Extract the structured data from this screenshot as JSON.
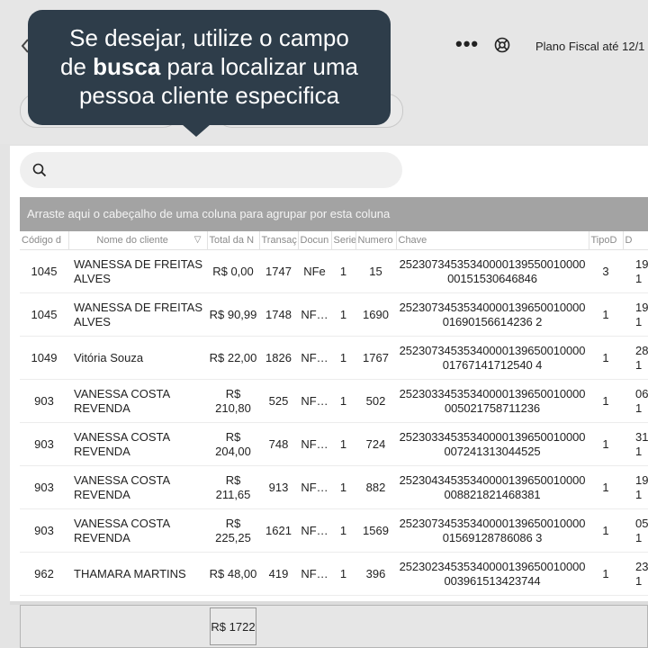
{
  "header": {
    "back_icon": "chevron-left-icon",
    "more_icon": "more-horizontal-icon",
    "help_icon": "lifebuoy-icon",
    "plan_label": "Plano Fiscal até 12/1"
  },
  "tooltip": {
    "line1": "Se desejar, utilize o campo",
    "line2_prefix": "de ",
    "line2_bold": "busca",
    "line2_suffix": " para localizar uma",
    "line3": "pessoa cliente especifica"
  },
  "search": {
    "placeholder": "",
    "value": "",
    "icon": "search-icon"
  },
  "group_bar": "Arraste aqui o cabeçalho de uma coluna para agrupar por esta coluna",
  "table": {
    "columns": [
      "Código d",
      "Nome do cliente",
      "Total da N",
      "Transaç",
      "Docun",
      "Serie",
      "Numero",
      "Chave",
      "TipoD",
      "D"
    ],
    "filter_icon": "filter-icon",
    "rows": [
      {
        "codigo": "1045",
        "nome": "WANESSA DE FREITAS ALVES",
        "total": "R$ 0,00",
        "transacao": "1747",
        "documento": "NFe",
        "serie": "1",
        "numero": "15",
        "chave": "2523073453534000013955001000000151530646846",
        "tipo": "3",
        "data": "19/\n1"
      },
      {
        "codigo": "1045",
        "nome": "WANESSA DE FREITAS ALVES",
        "total": "R$ 90,99",
        "transacao": "1748",
        "documento": "NF…",
        "serie": "1",
        "numero": "1690",
        "chave": "2523073453534000013965001000001690156614236 2",
        "tipo": "1",
        "data": "19/\n1"
      },
      {
        "codigo": "1049",
        "nome": "Vitória Souza",
        "total": "R$ 22,00",
        "transacao": "1826",
        "documento": "NF…",
        "serie": "1",
        "numero": "1767",
        "chave": "2523073453534000013965001000001767141712540 4",
        "tipo": "1",
        "data": "28/\n1"
      },
      {
        "codigo": "903",
        "nome": "VANESSA COSTA REVENDA",
        "total": "R$ 210,80",
        "transacao": "525",
        "documento": "NF…",
        "serie": "1",
        "numero": "502",
        "chave": "25230334535340000139650010000005021758711236",
        "tipo": "1",
        "data": "06/\n1"
      },
      {
        "codigo": "903",
        "nome": "VANESSA COSTA REVENDA",
        "total": "R$ 204,00",
        "transacao": "748",
        "documento": "NF…",
        "serie": "1",
        "numero": "724",
        "chave": "25230334535340000139650010000007241313044525",
        "tipo": "1",
        "data": "31/\n1"
      },
      {
        "codigo": "903",
        "nome": "VANESSA COSTA REVENDA",
        "total": "R$ 211,65",
        "transacao": "913",
        "documento": "NF…",
        "serie": "1",
        "numero": "882",
        "chave": "25230434535340000139650010000008821821468381",
        "tipo": "1",
        "data": "19/\n1"
      },
      {
        "codigo": "903",
        "nome": "VANESSA COSTA REVENDA",
        "total": "R$ 225,25",
        "transacao": "1621",
        "documento": "NF…",
        "serie": "1",
        "numero": "1569",
        "chave": "2523073453534000013965001000001569128786086 3",
        "tipo": "1",
        "data": "05/\n1"
      },
      {
        "codigo": "962",
        "nome": "THAMARA MARTINS",
        "total": "R$ 48,00",
        "transacao": "419",
        "documento": "NF…",
        "serie": "1",
        "numero": "396",
        "chave": "25230234535340000139650010000003961513423744",
        "tipo": "1",
        "data": "23/\n1"
      }
    ]
  },
  "footer": {
    "total": "R$ 1722"
  }
}
